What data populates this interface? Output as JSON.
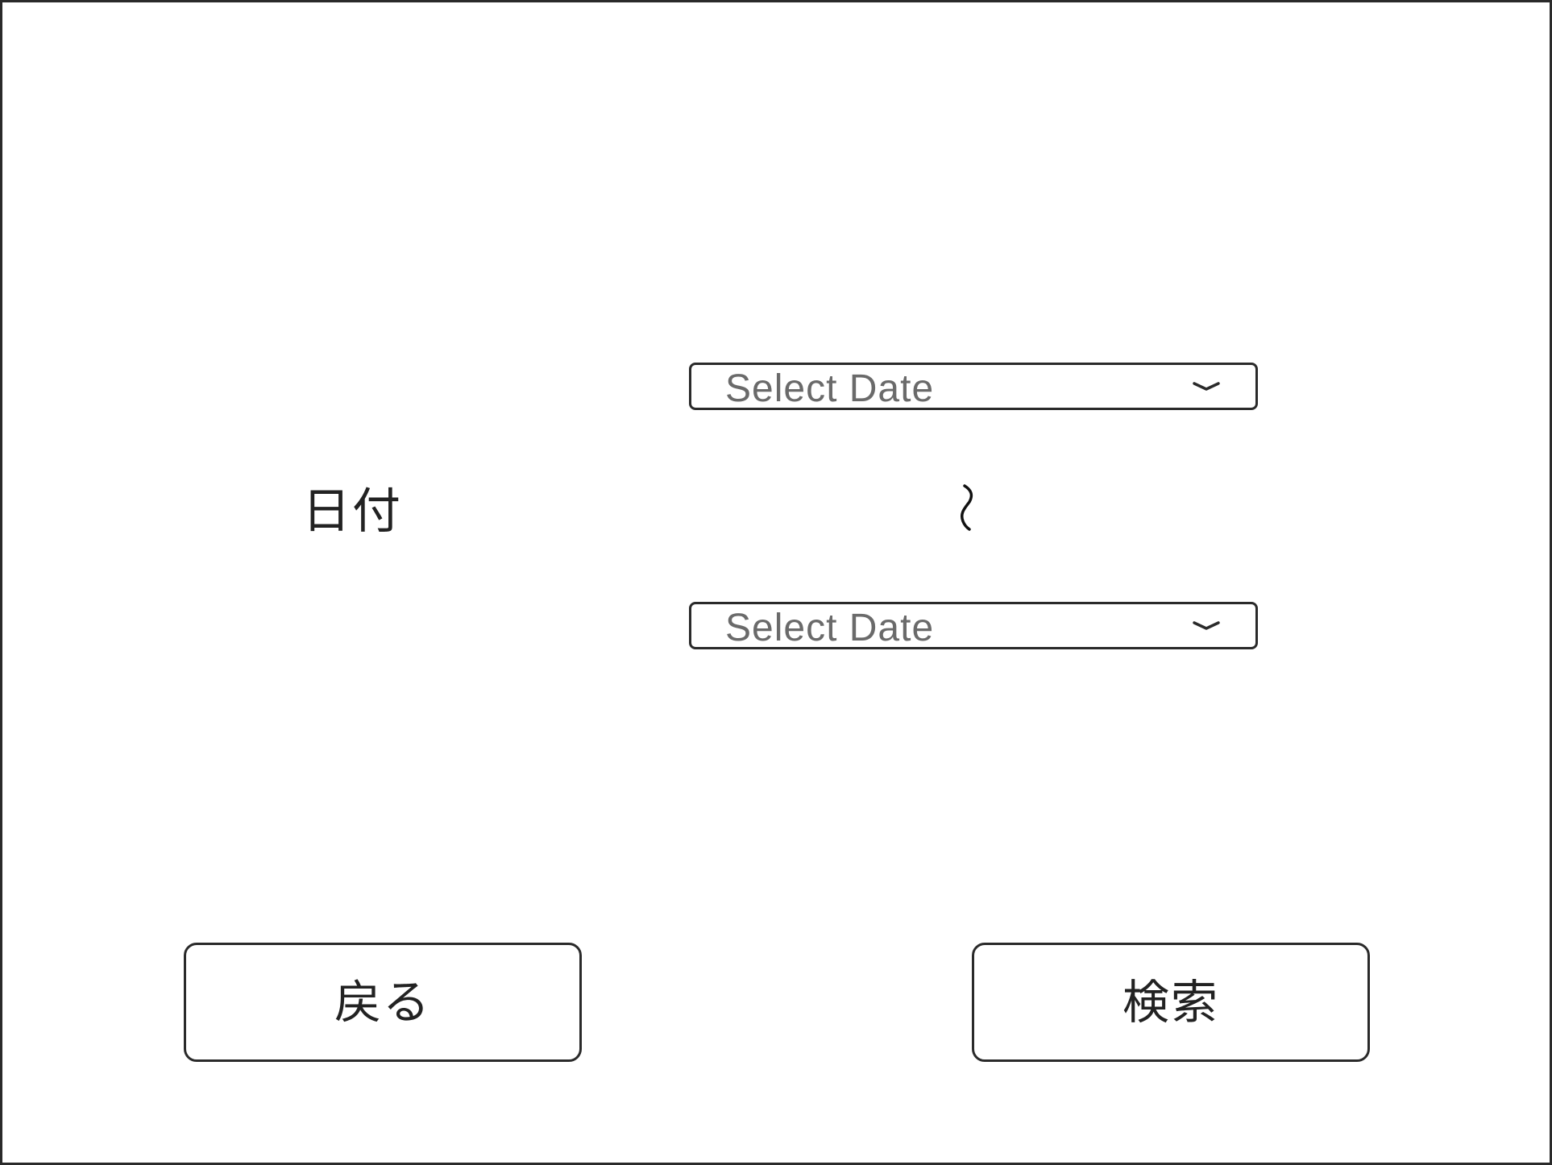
{
  "form": {
    "date_label": "日付",
    "from_select": {
      "placeholder": "Select Date",
      "icon": "chevron-down-icon"
    },
    "to_select": {
      "placeholder": "Select Date",
      "icon": "chevron-down-icon"
    },
    "range_separator": "～"
  },
  "actions": {
    "back_label": "戻る",
    "search_label": "検索"
  },
  "colors": {
    "border": "#2a2a2a",
    "text": "#222222",
    "placeholder": "#6a6a6a",
    "background": "#ffffff"
  }
}
